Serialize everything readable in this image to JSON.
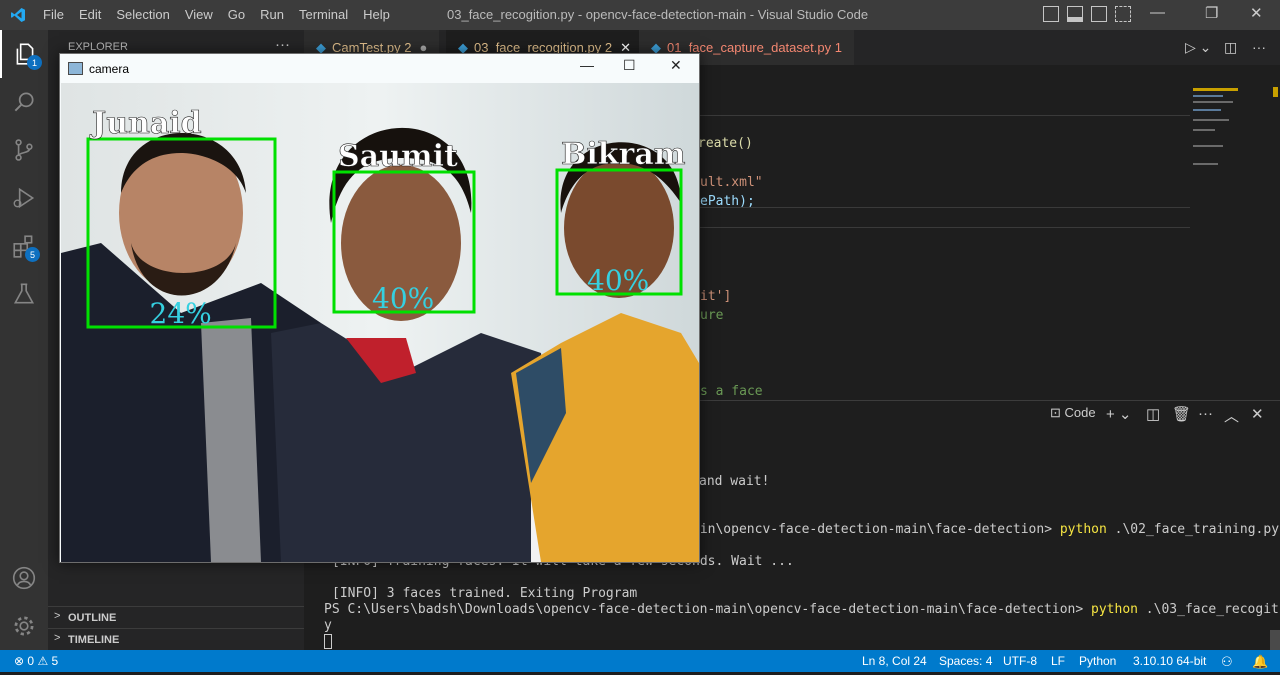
{
  "window": {
    "title": "03_face_recogition.py - opencv-face-detection-main - Visual Studio Code",
    "menu": [
      "File",
      "Edit",
      "Selection",
      "View",
      "Go",
      "Run",
      "Terminal",
      "Help"
    ],
    "controls": {
      "minimize": "—",
      "restore": "❐",
      "close": "✕"
    }
  },
  "activity": {
    "explorer_badge": "1",
    "extensions_badge": "5"
  },
  "sidebar": {
    "header": "EXPLORER",
    "more": "···",
    "sections": [
      {
        "label": "OUTLINE"
      },
      {
        "label": "TIMELINE"
      }
    ]
  },
  "tabs": [
    {
      "label": "CamTest.py",
      "suffix": "2",
      "state": "modified"
    },
    {
      "label": "03_face_recogition.py",
      "suffix": "2",
      "state": "active"
    },
    {
      "label": "01_face_capture_dataset.py",
      "suffix": "1",
      "state": "error"
    }
  ],
  "editor": {
    "fragments": [
      "reate()",
      "ult.xml\"",
      "ePath);",
      "it']",
      "ure",
      "s a face"
    ]
  },
  "panel": {
    "shell_label": "Code",
    "lines": [
      {
        "text": "and wait!",
        "cmd": "",
        "rest": ""
      },
      {
        "text": "ain\\opencv-face-detection-main\\face-detection> ",
        "cmd": "python",
        "rest": " .\\02_face_training.py"
      },
      {
        "text": "[INFO] Training faces. It will take a few seconds. Wait ...",
        "cmd": "",
        "rest": ""
      },
      {
        "text": "[INFO] 3 faces trained. Exiting Program",
        "cmd": "",
        "rest": ""
      },
      {
        "text": "PS C:\\Users\\badsh\\Downloads\\opencv-face-detection-main\\opencv-face-detection-main\\face-detection> ",
        "cmd": "python",
        "rest": " .\\03_face_recogition.p"
      },
      {
        "text": "y",
        "cmd": "",
        "rest": ""
      }
    ]
  },
  "statusbar": {
    "errors": "0",
    "warnings": "5",
    "position": "Ln 8, Col 24",
    "spaces": "Spaces: 4",
    "encoding": "UTF-8",
    "eol": "LF",
    "language": "Python",
    "interpreter": "3.10.10 64-bit"
  },
  "camera": {
    "title": "camera",
    "controls": {
      "minimize": "—",
      "maximize": "☐",
      "close": "✕"
    },
    "faces": [
      {
        "name": "Junaid",
        "confidence": "24%"
      },
      {
        "name": "Saumit",
        "confidence": "40%"
      },
      {
        "name": "Bikram",
        "confidence": "40%"
      }
    ]
  },
  "colors": {
    "accent": "#007acc",
    "box": "#00e000",
    "confidence": "#35d0e0"
  }
}
